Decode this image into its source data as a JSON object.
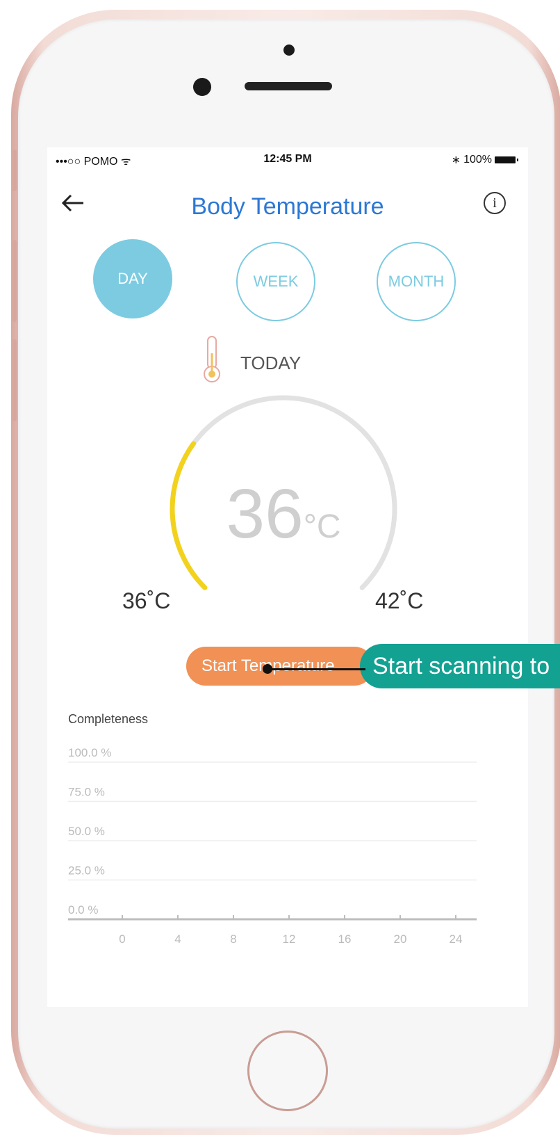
{
  "status_bar": {
    "carrier": "•••○○ POMO",
    "time": "12:45 PM",
    "battery": "100%"
  },
  "nav": {
    "title": "Body Temperature",
    "info_glyph": "i"
  },
  "period_tabs": [
    {
      "label": "DAY",
      "active": true
    },
    {
      "label": "WEEK",
      "active": false
    },
    {
      "label": "MONTH",
      "active": false
    }
  ],
  "today_label": "TODAY",
  "gauge": {
    "value": "36",
    "unit": "°C",
    "min_label": "36˚C",
    "max_label": "42˚C",
    "min": 36,
    "max": 42,
    "current": 36,
    "fill_fraction": 0.3,
    "fill_color": "#f2d21d",
    "track_color": "#e2e2e2"
  },
  "start_button": {
    "label": "Start Temperature"
  },
  "tooltip": {
    "text": "Start scanning to"
  },
  "chart_data": {
    "type": "line",
    "title": "Completeness",
    "y_tick_labels": [
      "100.0 %",
      "75.0 %",
      "50.0 %",
      "25.0 %",
      "0.0 %"
    ],
    "y_ticks": [
      100,
      75,
      50,
      25,
      0
    ],
    "x_ticks": [
      "0",
      "4",
      "8",
      "12",
      "16",
      "20",
      "24"
    ],
    "ylim": [
      0,
      100
    ],
    "xlim": [
      0,
      24
    ],
    "series": [],
    "grid": true
  },
  "colors": {
    "accent": "#2c78d4",
    "period": "#7ccbe1",
    "start_button": "#f19155",
    "tooltip": "#13a192"
  }
}
